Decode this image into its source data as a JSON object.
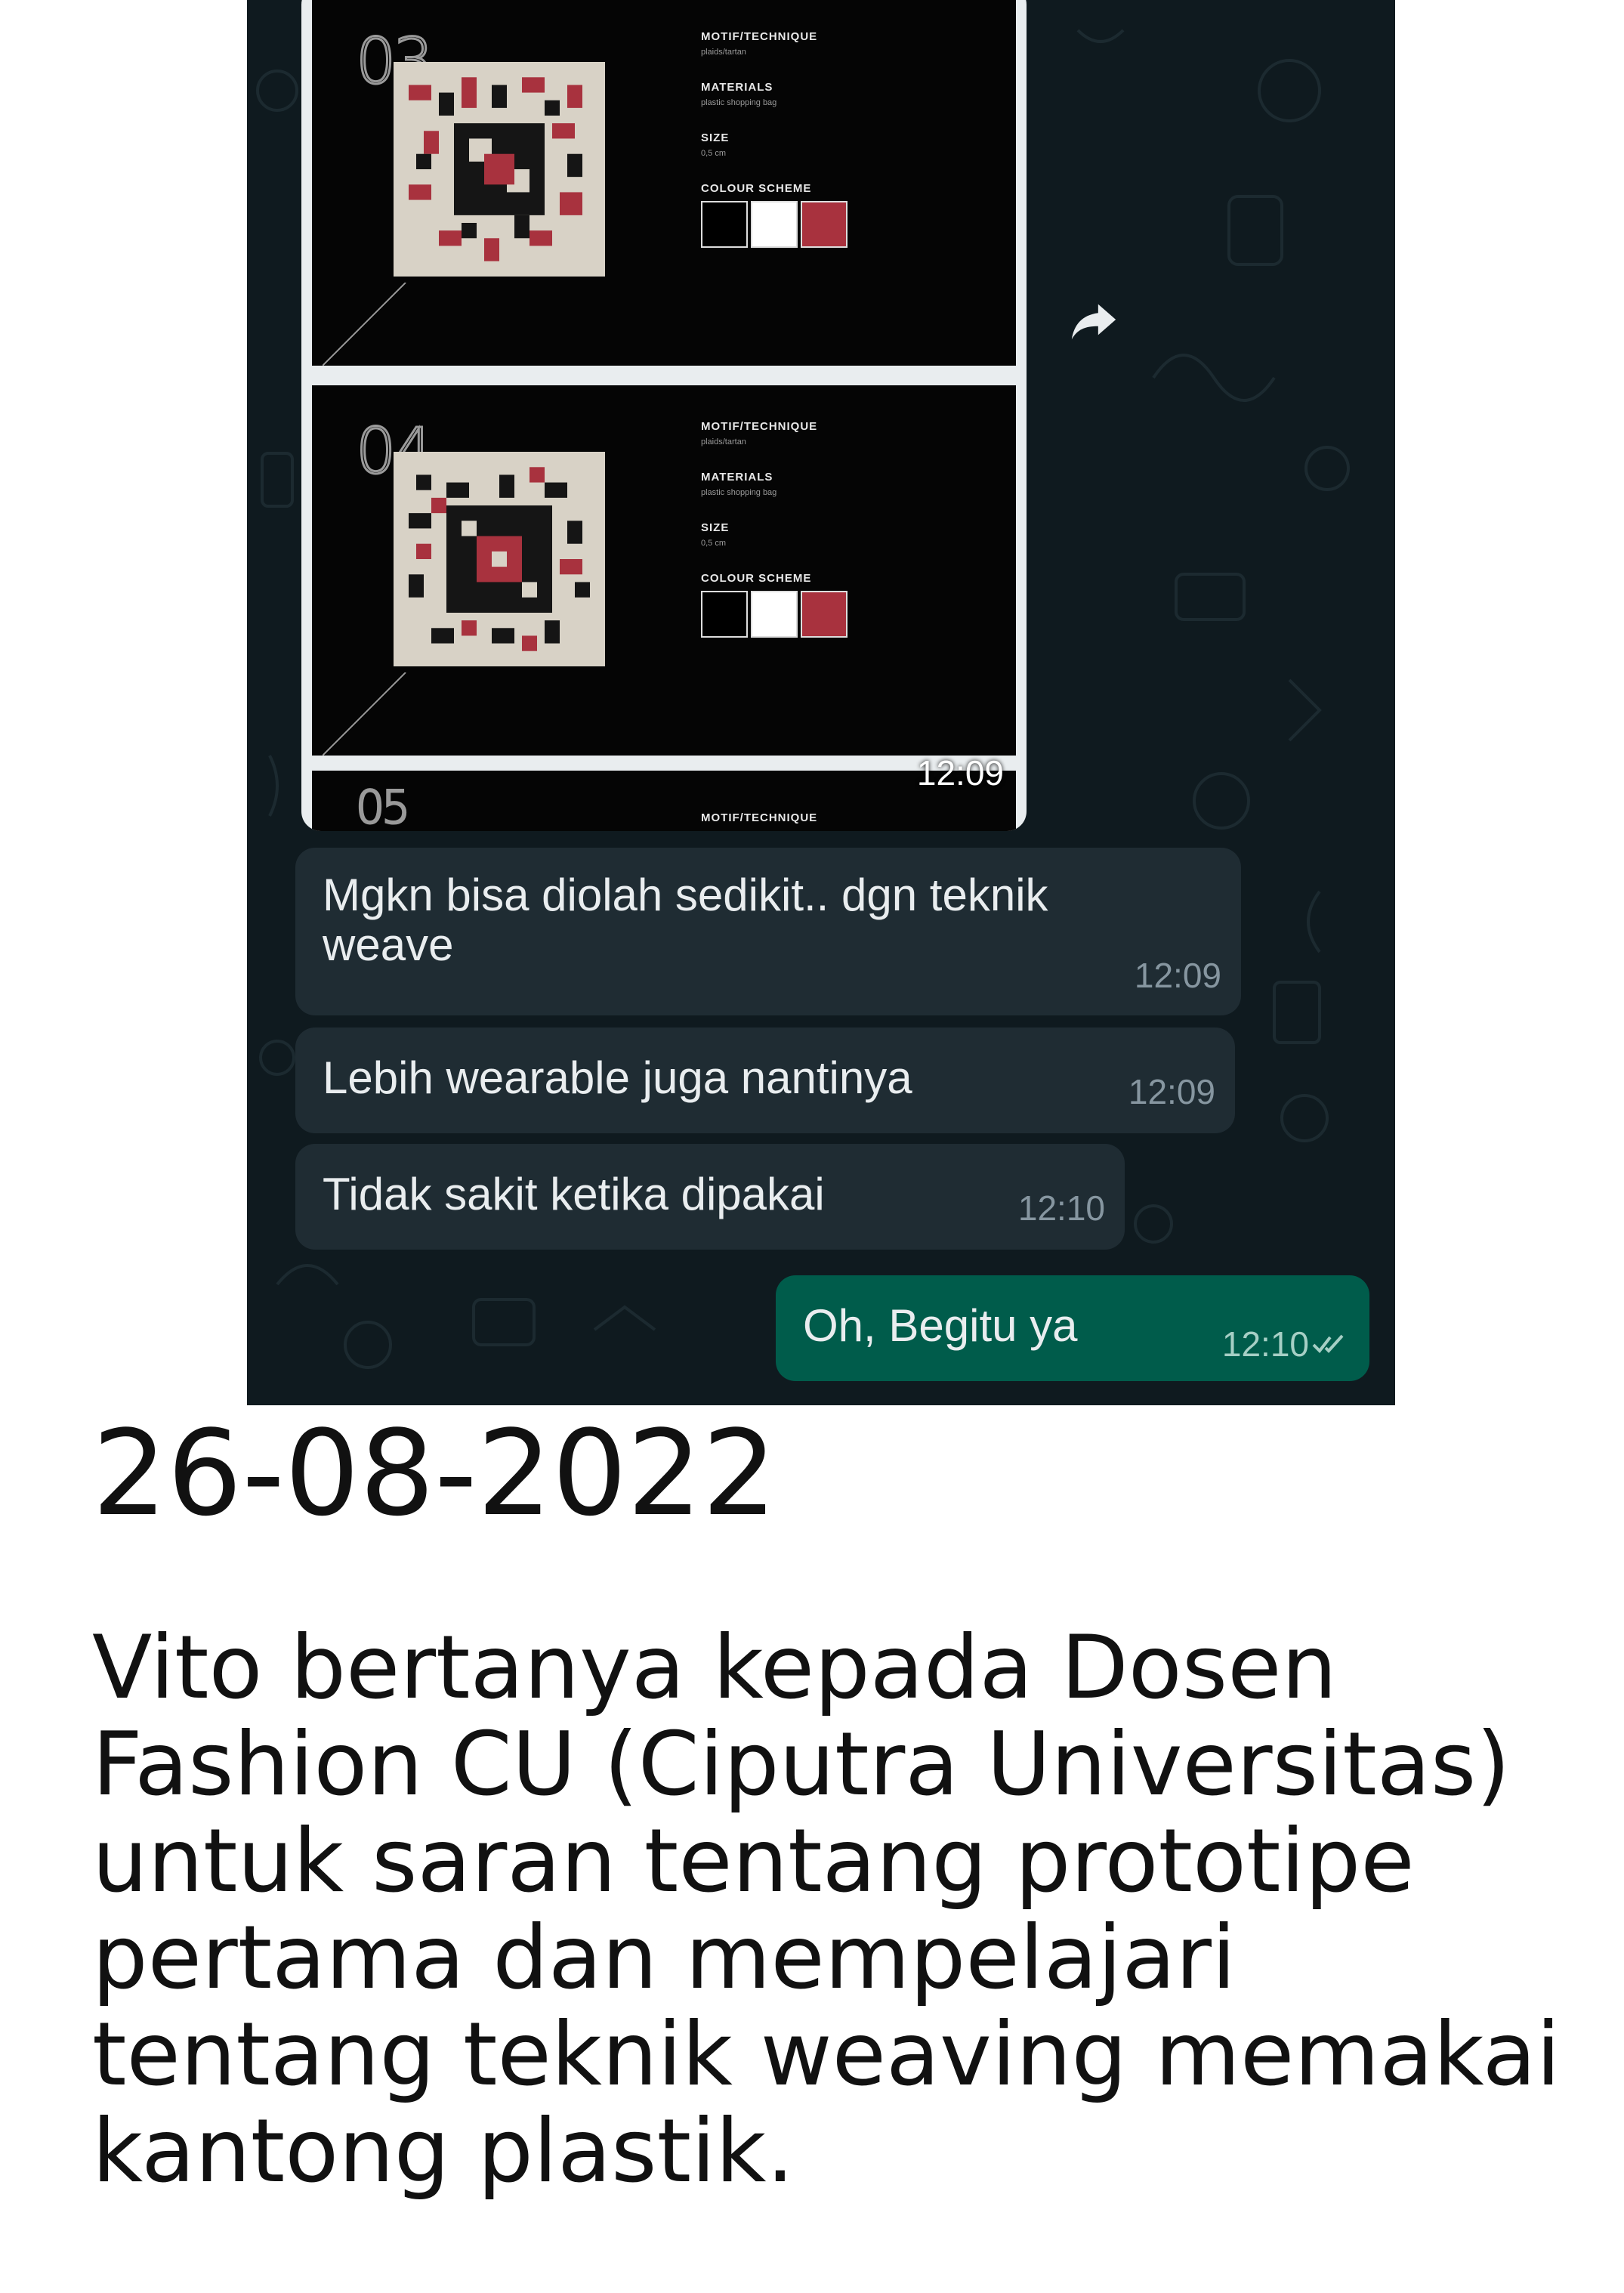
{
  "chat": {
    "media": {
      "cards": [
        {
          "number": "03",
          "motif_label": "MOTIF/TECHNIQUE",
          "motif_value": "plaids/tartan",
          "materials_label": "MATERIALS",
          "materials_value": "plastic shopping bag",
          "size_label": "SIZE",
          "size_value": "0,5 cm",
          "colour_label": "COLOUR SCHEME",
          "colours": [
            "#000000",
            "#ffffff",
            "#a8323e"
          ]
        },
        {
          "number": "04",
          "motif_label": "MOTIF/TECHNIQUE",
          "motif_value": "plaids/tartan",
          "materials_label": "MATERIALS",
          "materials_value": "plastic shopping bag",
          "size_label": "SIZE",
          "size_value": "0,5 cm",
          "colour_label": "COLOUR SCHEME",
          "colours": [
            "#000000",
            "#ffffff",
            "#a8323e"
          ]
        },
        {
          "number": "05",
          "motif_label": "MOTIF/TECHNIQUE"
        }
      ],
      "time": "12:09",
      "forward_icon": "forward-arrow-icon"
    },
    "messages": [
      {
        "text": "Mgkn bisa diolah sedikit.. dgn teknik weave",
        "time": "12:09",
        "direction": "incoming"
      },
      {
        "text": "Lebih wearable juga nantinya",
        "time": "12:09",
        "direction": "incoming"
      },
      {
        "text": "Tidak sakit ketika dipakai",
        "time": "12:10",
        "direction": "incoming"
      },
      {
        "text": "Oh, Begitu ya",
        "time": "12:10",
        "direction": "outgoing",
        "status": "read-double-check-icon"
      }
    ],
    "colors": {
      "background": "#0f1a1f",
      "incoming_bubble": "#1f2c33",
      "outgoing_bubble": "#005c4b"
    }
  },
  "caption": {
    "date": "26-08-2022",
    "description": "Vito bertanya kepada Dosen Fashion CU (Ciputra Universitas) untuk saran tentang prototipe pertama dan mempelajari tentang teknik weaving memakai kantong plastik."
  }
}
